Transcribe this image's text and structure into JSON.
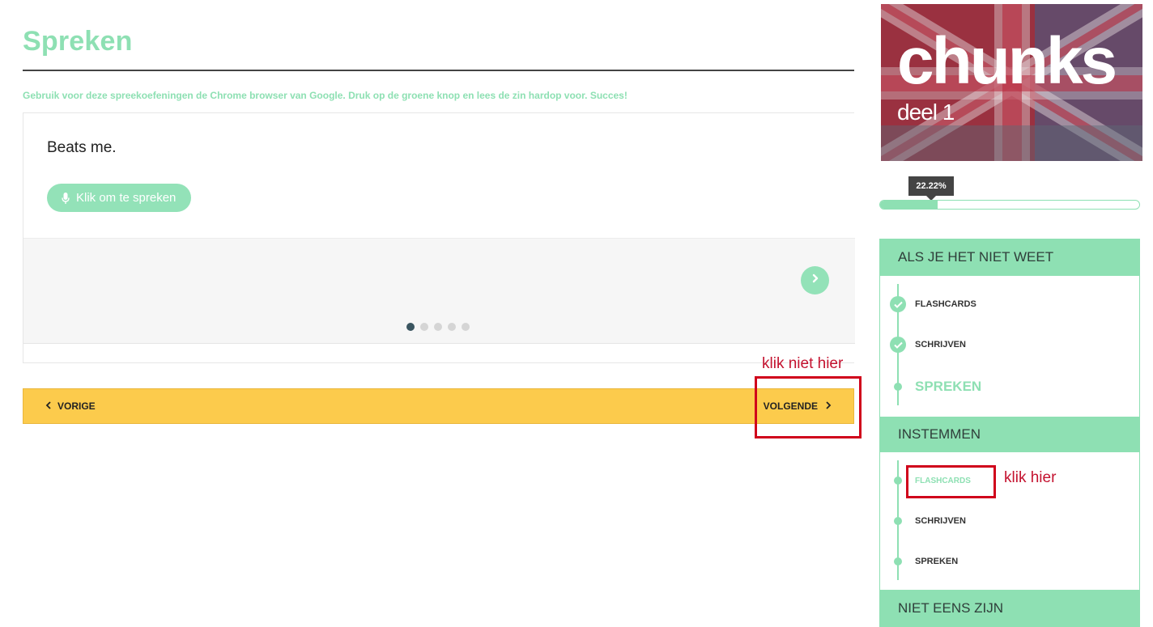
{
  "page": {
    "title": "Spreken",
    "instructions": "Gebruik voor deze spreekoefeningen de Chrome browser van Google. Druk op de groene knop en lees de zin hardop voor. Succes!"
  },
  "exercise": {
    "sentence": "Beats me.",
    "speak_button": "Klik om te spreken",
    "speak_icon": "microphone-icon",
    "next_icon": "chevron-right-icon",
    "slide_count": 5,
    "active_slide": 1
  },
  "navigation": {
    "prev_label": "VORIGE",
    "next_label": "VOLGENDE"
  },
  "annotations": {
    "dont_click": "klik niet hier",
    "click_here": "klik hier",
    "color": "#d0021b"
  },
  "sidebar": {
    "banner": {
      "title": "chunks",
      "subtitle": "deel 1"
    },
    "progress": {
      "label": "22.22%",
      "value": 22.22
    },
    "sections": [
      {
        "title": "ALS JE HET NIET WEET",
        "lessons": [
          {
            "label": "FLASHCARDS",
            "status": "done"
          },
          {
            "label": "SCHRIJVEN",
            "status": "done"
          },
          {
            "label": "SPREKEN",
            "status": "current"
          }
        ]
      },
      {
        "title": "INSTEMMEN",
        "lessons": [
          {
            "label": "FLASHCARDS",
            "status": "link"
          },
          {
            "label": "SCHRIJVEN",
            "status": "todo"
          },
          {
            "label": "SPREKEN",
            "status": "todo"
          }
        ]
      },
      {
        "title": "NIET EENS ZIJN",
        "lessons": []
      }
    ]
  },
  "colors": {
    "accent_green": "#8ee0b3",
    "nav_yellow": "#fccb4c",
    "annotation_red": "#d0021b"
  }
}
